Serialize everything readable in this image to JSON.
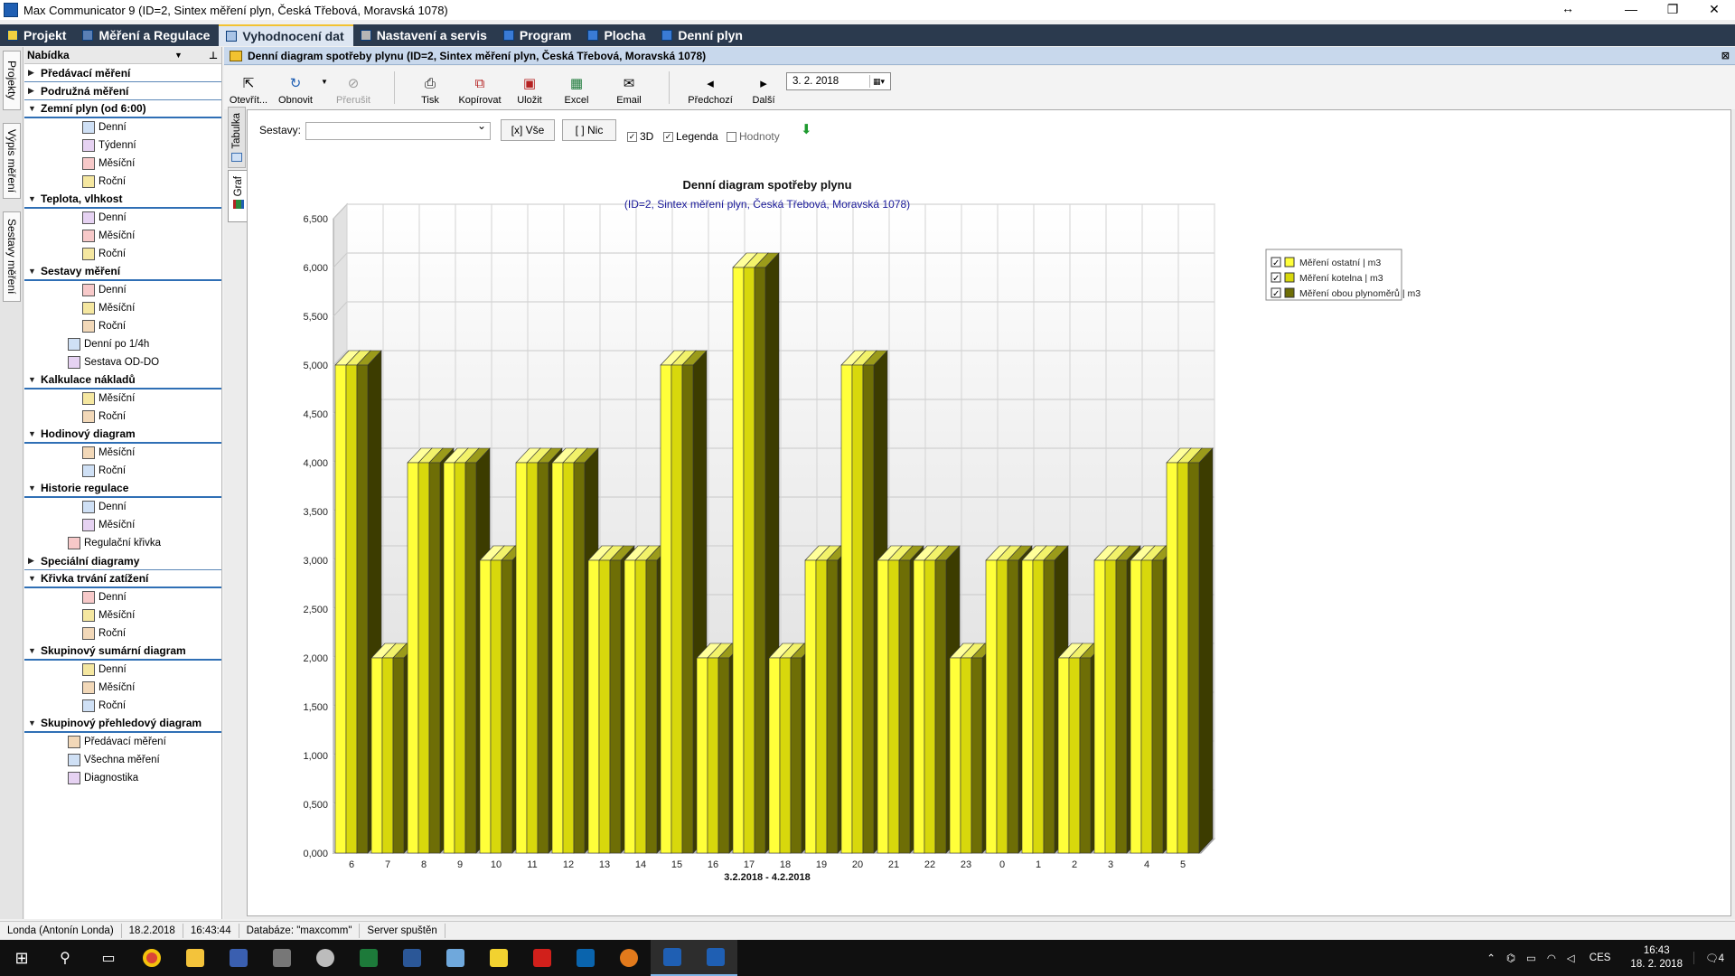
{
  "window": {
    "title": "Max Communicator 9 (ID=2, Sintex měření plyn, Česká Třebová, Moravská 1078)",
    "resize_glyph": "↔",
    "minimize": "—",
    "maximize": "❐",
    "close": "✕"
  },
  "menu": {
    "tabs": [
      {
        "label": "Projekt"
      },
      {
        "label": "Měření a Regulace"
      },
      {
        "label": "Vyhodnocení dat"
      },
      {
        "label": "Nastavení a servis"
      },
      {
        "label": "Program"
      },
      {
        "label": "Plocha"
      },
      {
        "label": "Denní plyn"
      }
    ]
  },
  "side_tabs": [
    "Projekty",
    "Výpis měření",
    "Sestavy měření"
  ],
  "nav": {
    "title": "Nabídka",
    "sections": [
      {
        "label": "Předávací měření",
        "open": false,
        "items": []
      },
      {
        "label": "Podružná měření",
        "open": false,
        "items": []
      },
      {
        "label": "Zemní plyn (od 6:00)",
        "open": true,
        "items": [
          "Denní",
          "Týdenní",
          "Měsíční",
          "Roční"
        ]
      },
      {
        "label": "Teplota, vlhkost",
        "open": true,
        "items": [
          "Denní",
          "Měsíční",
          "Roční"
        ]
      },
      {
        "label": "Sestavy měření",
        "open": true,
        "items": [
          "Denní",
          "Měsíční",
          "Roční",
          "Denní po 1/4h",
          "Sestava OD-DO"
        ]
      },
      {
        "label": "Kalkulace nákladů",
        "open": true,
        "items": [
          "Měsíční",
          "Roční"
        ]
      },
      {
        "label": "Hodinový diagram",
        "open": true,
        "items": [
          "Měsíční",
          "Roční"
        ]
      },
      {
        "label": "Historie regulace",
        "open": true,
        "items": [
          "Denní",
          "Měsíční",
          "Regulační křivka"
        ]
      },
      {
        "label": "Speciální diagramy",
        "open": false,
        "items": []
      },
      {
        "label": "Křivka trvání zatížení",
        "open": true,
        "items": [
          "Denní",
          "Měsíční",
          "Roční"
        ]
      },
      {
        "label": "Skupinový sumární diagram",
        "open": true,
        "items": [
          "Denní",
          "Měsíční",
          "Roční"
        ]
      },
      {
        "label": "Skupinový přehledový diagram",
        "open": true,
        "items": [
          "Předávací měření",
          "Všechna měření",
          "Diagnostika"
        ]
      }
    ]
  },
  "doc": {
    "title": "Denní diagram spotřeby plynu (ID=2, Sintex měření plyn, Česká Třebová, Moravská 1078)"
  },
  "toolbar": {
    "open": "Otevřít...",
    "refresh": "Obnovit",
    "stop": "Přerušit",
    "print": "Tisk",
    "copy": "Kopírovat",
    "save": "Uložit",
    "excel": "Excel",
    "email": "Email",
    "prev": "Předchozí",
    "next": "Další",
    "date": "3. 2. 2018"
  },
  "view_tabs": {
    "table": "Tabulka",
    "graph": "Graf"
  },
  "filter": {
    "sestavy_label": "Sestavy:",
    "all_button": "[x] Vše",
    "none_button": "[ ] Nic",
    "chk_3d": "3D",
    "chk_legend": "Legenda",
    "chk_values": "Hodnoty"
  },
  "colors": {
    "series_light": "#ffff3a",
    "series_mid": "#d8d80c",
    "series_dark": "#6e6e06",
    "menubar": "#2b3a4e"
  },
  "chart_data": {
    "type": "bar",
    "title": "Denní diagram spotřeby plynu",
    "subtitle": "(ID=2, Sintex měření plyn, Česká Třebová, Moravská 1078)",
    "xlabel": "3.2.2018 - 4.2.2018",
    "ylabel": "",
    "ylim": [
      0,
      6.5
    ],
    "y_ticks": [
      "0,000",
      "0,500",
      "1,000",
      "1,500",
      "2,000",
      "2,500",
      "3,000",
      "3,500",
      "4,000",
      "4,500",
      "5,000",
      "5,500",
      "6,000",
      "6,500"
    ],
    "categories": [
      "6",
      "7",
      "8",
      "9",
      "10",
      "11",
      "12",
      "13",
      "14",
      "15",
      "16",
      "17",
      "18",
      "19",
      "20",
      "21",
      "22",
      "23",
      "0",
      "1",
      "2",
      "3",
      "4",
      "5"
    ],
    "series": [
      {
        "name": "Měření ostatní | m3",
        "values": [
          5,
          2,
          4,
          4,
          3,
          4,
          4,
          3,
          3,
          5,
          2,
          6,
          2,
          3,
          5,
          3,
          3,
          2,
          3,
          3,
          2,
          3,
          3,
          4
        ]
      },
      {
        "name": "Měření kotelna | m3",
        "values": [
          5,
          2,
          4,
          4,
          3,
          4,
          4,
          3,
          3,
          5,
          2,
          6,
          2,
          3,
          5,
          3,
          3,
          2,
          3,
          3,
          2,
          3,
          3,
          4
        ]
      },
      {
        "name": "Měření obou plynoměrů | m3",
        "values": [
          5,
          2,
          4,
          4,
          3,
          4,
          4,
          3,
          3,
          5,
          2,
          6,
          2,
          3,
          5,
          3,
          3,
          2,
          3,
          3,
          2,
          3,
          3,
          4
        ]
      }
    ],
    "legend_position": "top-right",
    "grid": true,
    "three_d": true
  },
  "status": {
    "user": "Londa (Antonín Londa)",
    "date": "18.2.2018",
    "time": "16:43:44",
    "database": "Databáze: \"maxcomm\"",
    "server": "Server spuštěn"
  },
  "taskbar": {
    "lang": "CES",
    "time": "16:43",
    "date": "18. 2. 2018",
    "notifications": "4"
  }
}
